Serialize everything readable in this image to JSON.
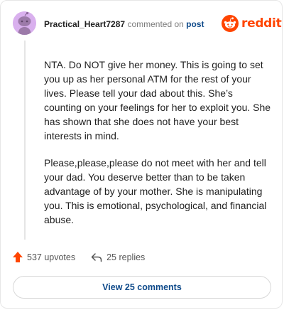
{
  "comment": {
    "username": "Practical_Heart7287",
    "action": "commented on",
    "post_link": "post",
    "paragraphs": [
      "NTA. Do NOT give her money. This is going to set you up as her personal ATM for the rest of your lives. Please tell your dad about this. She’s counting on your feelings for her to exploit you. She has shown that she does not have your best interests in mind.",
      "Please,please,please do not meet with her and tell your dad. You deserve better than to be taken advantage of by your mother. She is manipulating you. This is emotional, psychological, and financial abuse."
    ]
  },
  "brand": {
    "wordmark": "reddit",
    "color": "#ff4500"
  },
  "footer": {
    "upvotes": "537 upvotes",
    "replies": "25 replies",
    "view_comments": "View 25 comments"
  },
  "icons": {
    "avatar": "snoo-avatar-icon",
    "logo": "reddit-snoo-icon",
    "upvote": "upvote-arrow-icon",
    "reply": "reply-arrow-icon"
  }
}
